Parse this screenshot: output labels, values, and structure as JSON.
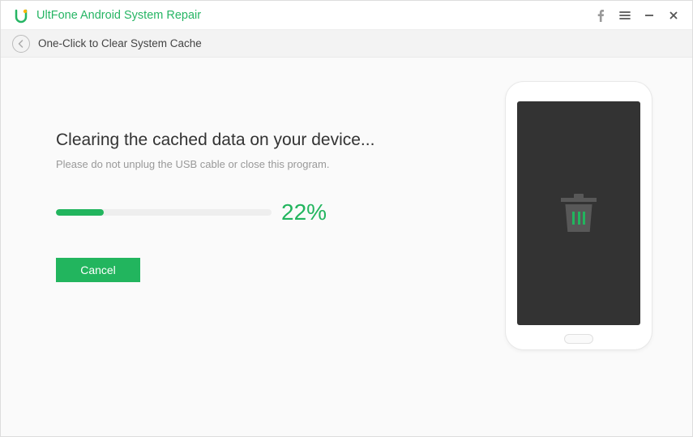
{
  "titlebar": {
    "title": "UltFone Android System Repair"
  },
  "subheader": {
    "breadcrumb": "One-Click to Clear System Cache"
  },
  "main": {
    "headline": "Clearing the cached data on your device...",
    "subtext": "Please do not unplug the USB cable or close this program.",
    "percent_label": "22%",
    "percent_value": 22,
    "cancel_label": "Cancel"
  },
  "colors": {
    "accent": "#22b55e"
  }
}
